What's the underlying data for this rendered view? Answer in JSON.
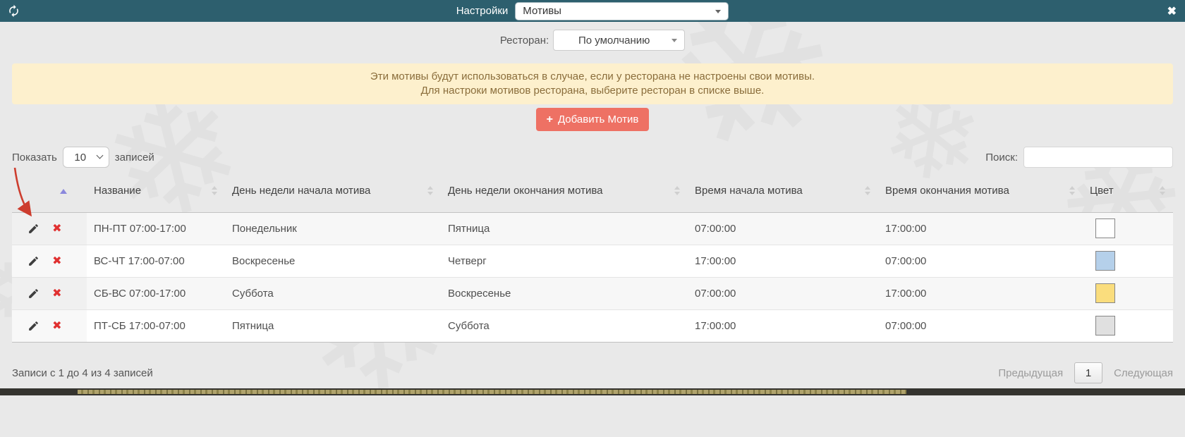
{
  "topbar": {
    "title": "Настройки",
    "section_select_value": "Мотивы",
    "close_glyph": "✖"
  },
  "restaurant": {
    "label": "Ресторан:",
    "select_value": "По умолчанию"
  },
  "banner": {
    "line1": "Эти мотивы будут использоваться в случае, если у ресторана не настроены свои мотивы.",
    "line2": "Для настроки мотивов ресторана, выберите ресторан в списке выше."
  },
  "add_button": {
    "plus": "+",
    "label": "Добавить Мотив"
  },
  "table_controls": {
    "show_label": "Показать",
    "page_size": "10",
    "records_label": "записей",
    "search_label": "Поиск:",
    "search_value": ""
  },
  "table": {
    "columns": {
      "actions": "",
      "name": "Название",
      "start_day": "День недели начала мотива",
      "end_day": "День недели окончания мотива",
      "start_time": "Время начала мотива",
      "end_time": "Время окончания мотива",
      "color": "Цвет"
    },
    "rows": [
      {
        "name": "ПН-ПТ 07:00-17:00",
        "start_day": "Понедельник",
        "end_day": "Пятница",
        "start_time": "07:00:00",
        "end_time": "17:00:00",
        "color": "#ffffff"
      },
      {
        "name": "ВС-ЧТ 17:00-07:00",
        "start_day": "Воскресенье",
        "end_day": "Четверг",
        "start_time": "17:00:00",
        "end_time": "07:00:00",
        "color": "#b5d0ea"
      },
      {
        "name": "СБ-ВС 07:00-17:00",
        "start_day": "Суббота",
        "end_day": "Воскресенье",
        "start_time": "07:00:00",
        "end_time": "17:00:00",
        "color": "#fadd7d"
      },
      {
        "name": "ПТ-СБ 17:00-07:00",
        "start_day": "Пятница",
        "end_day": "Суббота",
        "start_time": "17:00:00",
        "end_time": "07:00:00",
        "color": "#e0e0e0"
      }
    ]
  },
  "footer": {
    "info": "Записи с 1 до 4 из 4 записей",
    "prev_label": "Предыдущая",
    "page": "1",
    "next_label": "Следующая"
  },
  "icons": {
    "delete_glyph": "✖",
    "flake_glyph": "❄"
  },
  "colors": {
    "topbar_bg": "#2d5f6e",
    "banner_bg": "#fdf0cd",
    "banner_text": "#8a6d3b",
    "button_bg": "#ee7164",
    "delete_red": "#e03030",
    "arrow_red": "#cd3d2e"
  }
}
